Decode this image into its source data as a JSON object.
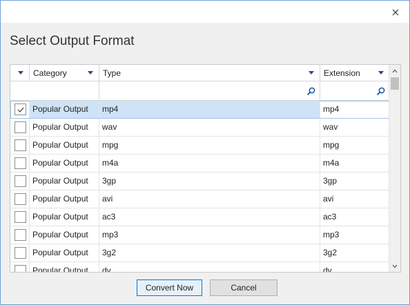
{
  "dialog": {
    "title": "Select Output Format"
  },
  "grid": {
    "columns": {
      "category": "Category",
      "type": "Type",
      "extension": "Extension"
    },
    "rows": [
      {
        "checked": true,
        "category": "Popular Output",
        "type": "mp4",
        "extension": "mp4"
      },
      {
        "checked": false,
        "category": "Popular Output",
        "type": "wav",
        "extension": "wav"
      },
      {
        "checked": false,
        "category": "Popular Output",
        "type": "mpg",
        "extension": "mpg"
      },
      {
        "checked": false,
        "category": "Popular Output",
        "type": "m4a",
        "extension": "m4a"
      },
      {
        "checked": false,
        "category": "Popular Output",
        "type": "3gp",
        "extension": "3gp"
      },
      {
        "checked": false,
        "category": "Popular Output",
        "type": "avi",
        "extension": "avi"
      },
      {
        "checked": false,
        "category": "Popular Output",
        "type": "ac3",
        "extension": "ac3"
      },
      {
        "checked": false,
        "category": "Popular Output",
        "type": "mp3",
        "extension": "mp3"
      },
      {
        "checked": false,
        "category": "Popular Output",
        "type": "3g2",
        "extension": "3g2"
      },
      {
        "checked": false,
        "category": "Popular Output",
        "type": "dv",
        "extension": "dv"
      }
    ]
  },
  "buttons": {
    "convert": "Convert Now",
    "cancel": "Cancel"
  },
  "colors": {
    "selected_row": "#cfe3f7",
    "accent": "#0078d7"
  },
  "icons": {
    "close": "close-icon",
    "search": "search-icon",
    "sort": "chevron-down-icon",
    "check": "check-icon"
  }
}
